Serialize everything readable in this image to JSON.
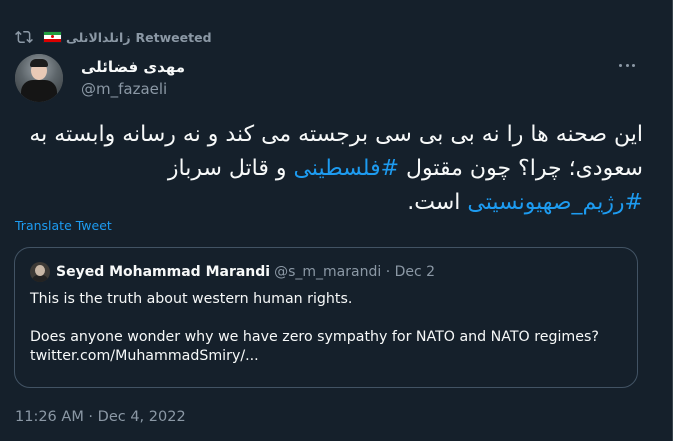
{
  "retweet": {
    "icon": "retweet-icon",
    "flag": "iran-flag",
    "name": "زانلدالانلى",
    "label": "Retweeted"
  },
  "tweet": {
    "author_name": "مهدی فضائلی",
    "author_handle": "@m_fazaeli",
    "text_parts": {
      "p1": "این صحنه ها را نه بی بی سی برجسته می کند و نه رسانه وابسته به سعودی؛ چرا؟ چون مقتول ",
      "hashtag1": "#فلسطینی",
      "p2": " و قاتل سرباز ",
      "hashtag2": "#رژیم_صهیونسیتی",
      "p3": " است."
    },
    "translate_label": "Translate Tweet",
    "timestamp": "11:26 AM · Dec 4, 2022"
  },
  "quote": {
    "name": "Seyed Mohammad Marandi",
    "meta": "@s_m_marandi · Dec 2",
    "line1": "This is the truth about western human rights.",
    "line2": "Does anyone wonder why we have zero sympathy for NATO and NATO regimes?",
    "line3": "twitter.com/MuhammadSmiry/..."
  },
  "colors": {
    "background": "#15202b",
    "accent": "#1d9bf0",
    "secondary_text": "#8b98a5",
    "border": "#425364"
  }
}
